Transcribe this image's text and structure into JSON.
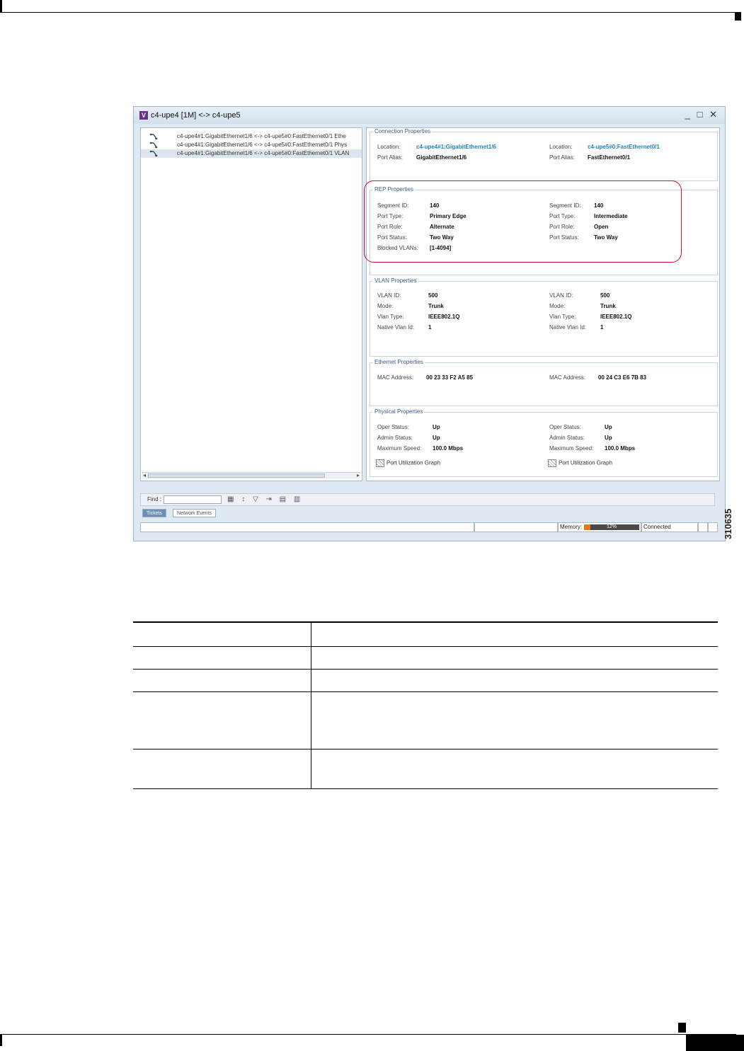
{
  "window": {
    "icon_letter": "V",
    "title": "c4-upe4 [1M] <-> c4-upe5",
    "controls": "_ □ ✕"
  },
  "tree": {
    "rows": [
      "c4-upe4#1:GigabitEthernet1/6 <-> c4-upe5#0:FastEthernet0/1 Ethe",
      "c4-upe4#1:GigabitEthernet1/6 <-> c4-upe5#0:FastEthernet0/1 Phys",
      "c4-upe4#1:GigabitEthernet1/6 <-> c4-upe5#0:FastEthernet0/1 VLAN"
    ],
    "selected_index": 2
  },
  "connection": {
    "title": "Connection Properties",
    "left": {
      "location_label": "Location:",
      "location": "c4-upe4#1:GigabitEthernet1/6",
      "alias_label": "Port Alias:",
      "alias": "GigabitEthernet1/6"
    },
    "right": {
      "location_label": "Location:",
      "location": "c4-upe5#0:FastEthernet0/1",
      "alias_label": "Port Alias:",
      "alias": "FastEthernet0/1"
    }
  },
  "rep": {
    "title": "REP Properties",
    "left": {
      "segment_label": "Segment ID:",
      "segment": "140",
      "type_label": "Port Type:",
      "type": "Primary Edge",
      "role_label": "Port Role:",
      "role": "Alternate",
      "status_label": "Port Status:",
      "status": "Two Way",
      "blocked_label": "Blocked VLANs:",
      "blocked": "[1-4094]"
    },
    "right": {
      "segment_label": "Segment ID:",
      "segment": "140",
      "type_label": "Port Type:",
      "type": "Intermediate",
      "role_label": "Port Role:",
      "role": "Open",
      "status_label": "Port Status:",
      "status": "Two Way"
    }
  },
  "vlan": {
    "title": "VLAN Properties",
    "left": {
      "id_label": "VLAN ID:",
      "id": "500",
      "mode_label": "Mode:",
      "mode": "Trunk",
      "type_label": "Vlan Type:",
      "type": "IEEE802.1Q",
      "native_label": "Native Vlan Id:",
      "native": "1"
    },
    "right": {
      "id_label": "VLAN ID:",
      "id": "500",
      "mode_label": "Mode:",
      "mode": "Trunk",
      "type_label": "Vlan Type:",
      "type": "IEEE802.1Q",
      "native_label": "Native Vlan Id:",
      "native": "1"
    }
  },
  "ethernet": {
    "title": "Ethernet Properties",
    "left": {
      "mac_label": "MAC Address:",
      "mac": "00 23 33 F2 A5 85"
    },
    "right": {
      "mac_label": "MAC Address:",
      "mac": "00 24 C3 E6 7B 83"
    }
  },
  "physical": {
    "title": "Physical Properties",
    "left": {
      "oper_label": "Oper Status:",
      "oper": "Up",
      "admin_label": "Admin Status:",
      "admin": "Up",
      "speed_label": "Maximum Speed:",
      "speed": "100.0 Mbps",
      "graph": "Port Utilization Graph"
    },
    "right": {
      "oper_label": "Oper Status:",
      "oper": "Up",
      "admin_label": "Admin Status:",
      "admin": "Up",
      "speed_label": "Maximum Speed:",
      "speed": "100.0 Mbps",
      "graph": "Port Utilization Graph"
    }
  },
  "bottom": {
    "find_label": "Find :",
    "find_value": "",
    "tool_icons": "▦ ↕ ▽ ⇥ ▤ ▥",
    "tab_tickets": "Tickets",
    "tab_events": "Network Events",
    "memory_label": "Memory:",
    "memory_text": "12%",
    "memory_fraction": 0.12,
    "connection_status": "Connected"
  },
  "figure_number": "310635",
  "colors": {
    "highlight": "#c8102e",
    "link": "#1e7fc0",
    "memory_fill": "#e07b1a"
  }
}
